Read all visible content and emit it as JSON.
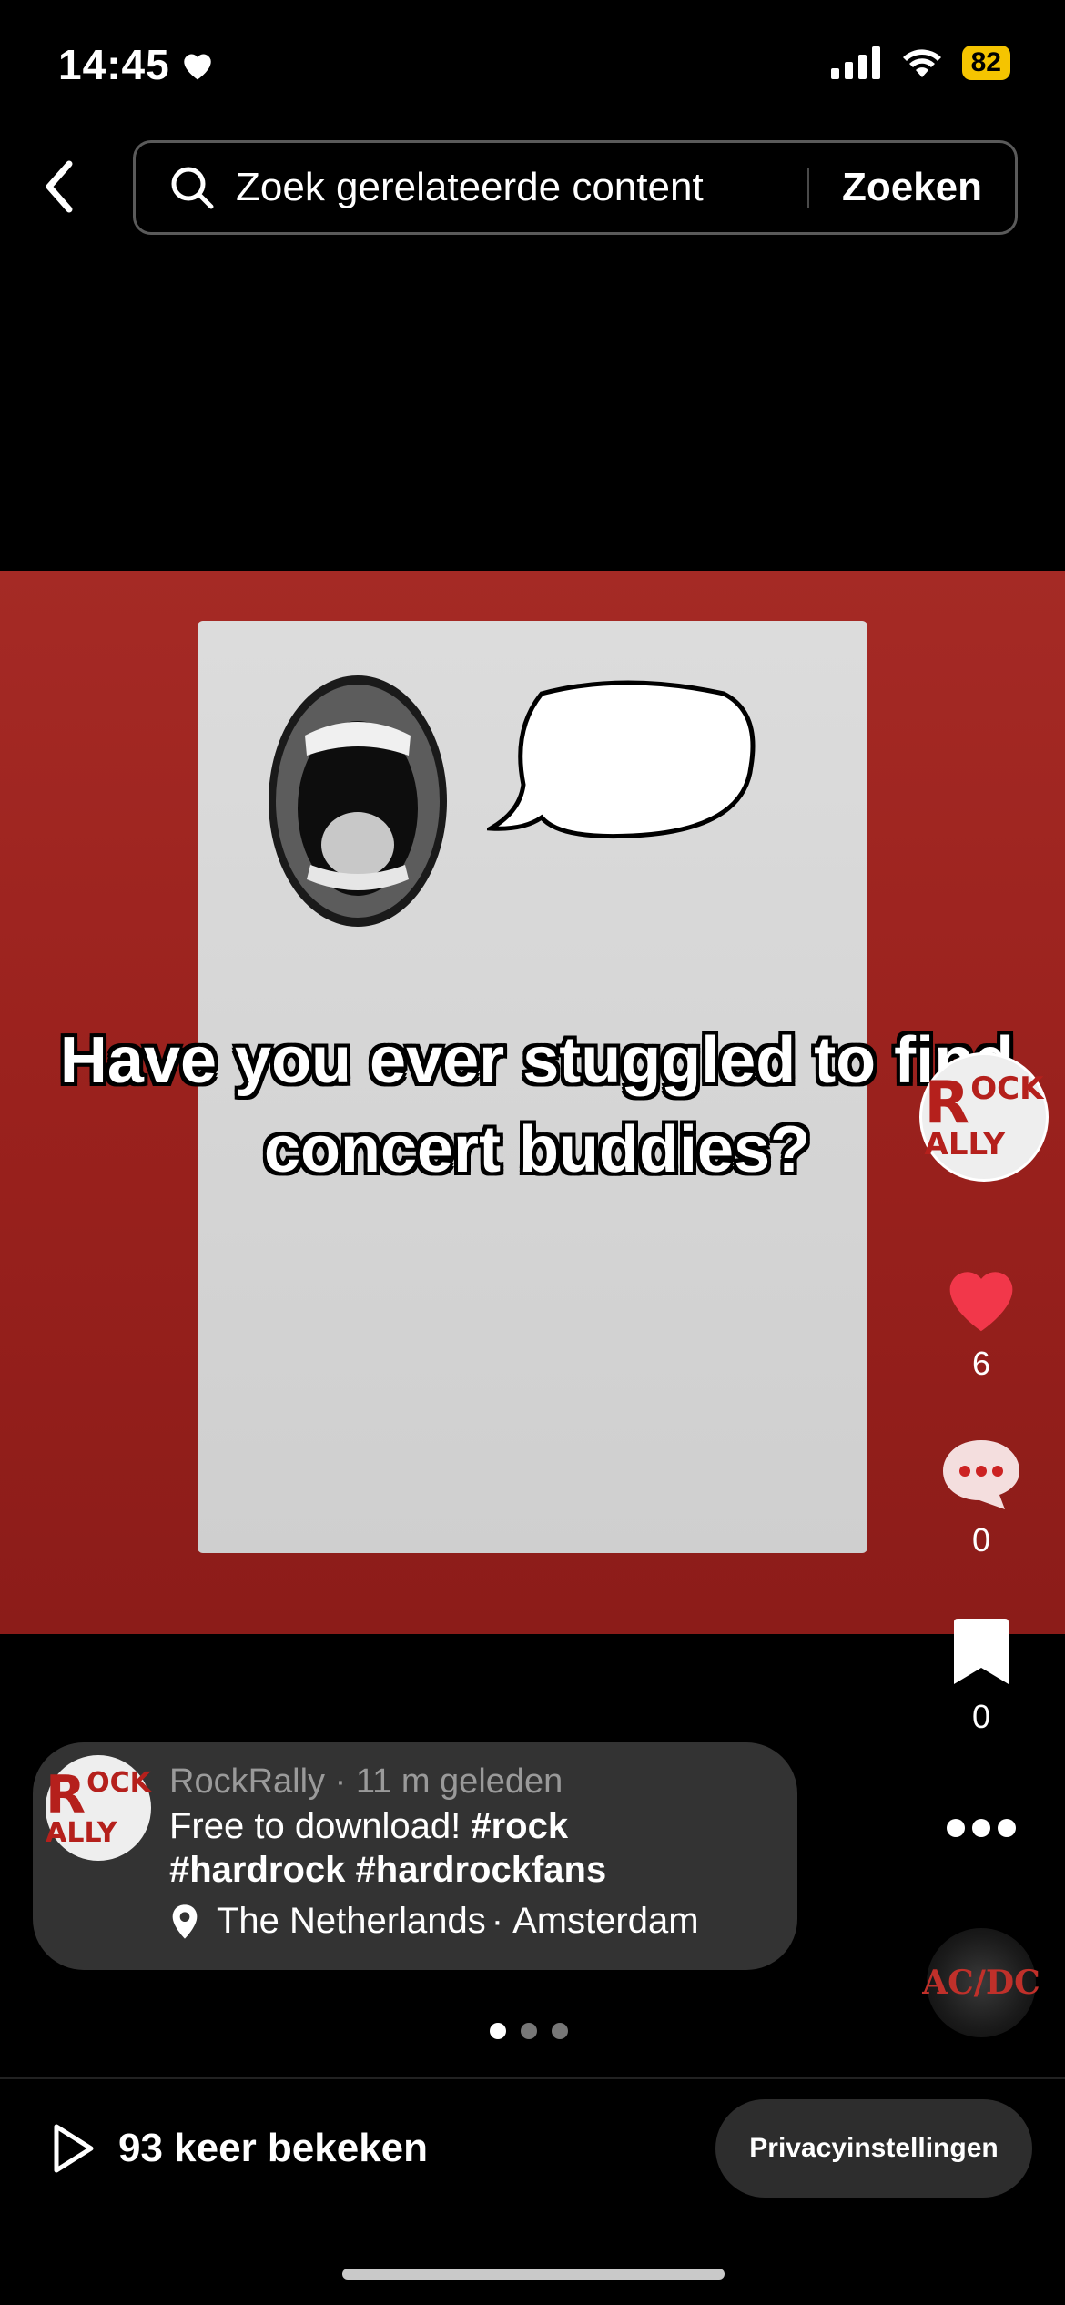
{
  "status_bar": {
    "time": "14:45",
    "battery": "82"
  },
  "search": {
    "placeholder": "Zoek gerelateerde content",
    "button_label": "Zoeken"
  },
  "video": {
    "caption": "Have you ever stuggled to find concert buddies?"
  },
  "creator_logo": {
    "line1": "OCK",
    "line2": "ALLY",
    "initial1": "R",
    "initial2": "R"
  },
  "actions": {
    "likes": "6",
    "comments": "0",
    "saves": "0"
  },
  "post": {
    "author": "RockRally",
    "time_ago": "11 m geleden",
    "description": "Free to download!",
    "hashtags": [
      "#rock",
      "#hardrock",
      "#hardrockfans"
    ],
    "location": "The Netherlands",
    "city": "Amsterdam"
  },
  "carousel": {
    "total": 3,
    "active": 0
  },
  "music_disc": {
    "label": "AC/DC"
  },
  "footer": {
    "views": "93 keer bekeken",
    "privacy_label": "Privacyinstellingen"
  },
  "colors": {
    "accent_red": "#f2374a",
    "video_bg": "#9e231f",
    "battery": "#f5c400"
  }
}
